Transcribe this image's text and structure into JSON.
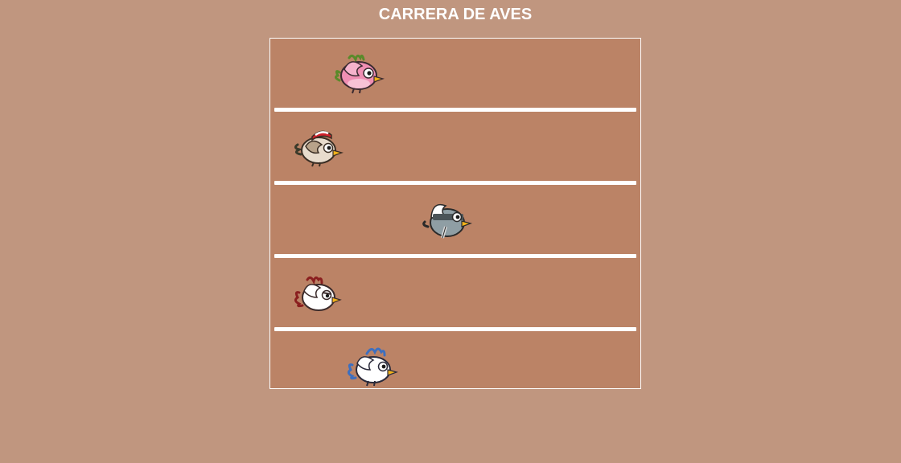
{
  "header": {
    "title": "CARRERA DE AVES"
  },
  "race": {
    "lanes": [
      {
        "bird": "pink-bird-icon",
        "progress": 0.19,
        "colors": {
          "body": "#f08fb4",
          "wing": "#f5b3cc",
          "crest": "#6a9a3a"
        }
      },
      {
        "bird": "cap-bird-icon",
        "progress": 0.08,
        "colors": {
          "body": "#e8dccd",
          "wing": "#b8a38a",
          "crest": "#d0202a"
        }
      },
      {
        "bird": "ninja-bird-icon",
        "progress": 0.42,
        "colors": {
          "body": "#8f9ea4",
          "wing": "#ffffff",
          "crest": "#3a3a3a"
        }
      },
      {
        "bird": "red-crest-bird-icon",
        "progress": 0.08,
        "colors": {
          "body": "#ffffff",
          "wing": "#ffffff",
          "crest": "#8a1f1f"
        }
      },
      {
        "bird": "blue-crest-bird-icon",
        "progress": 0.22,
        "colors": {
          "body": "#ffffff",
          "wing": "#ffffff",
          "crest": "#3d6fbf"
        }
      }
    ]
  },
  "theme": {
    "background": "#c0967f",
    "track": "#bb8366",
    "lines": "#ffffff",
    "beak": "#f2b21a"
  }
}
